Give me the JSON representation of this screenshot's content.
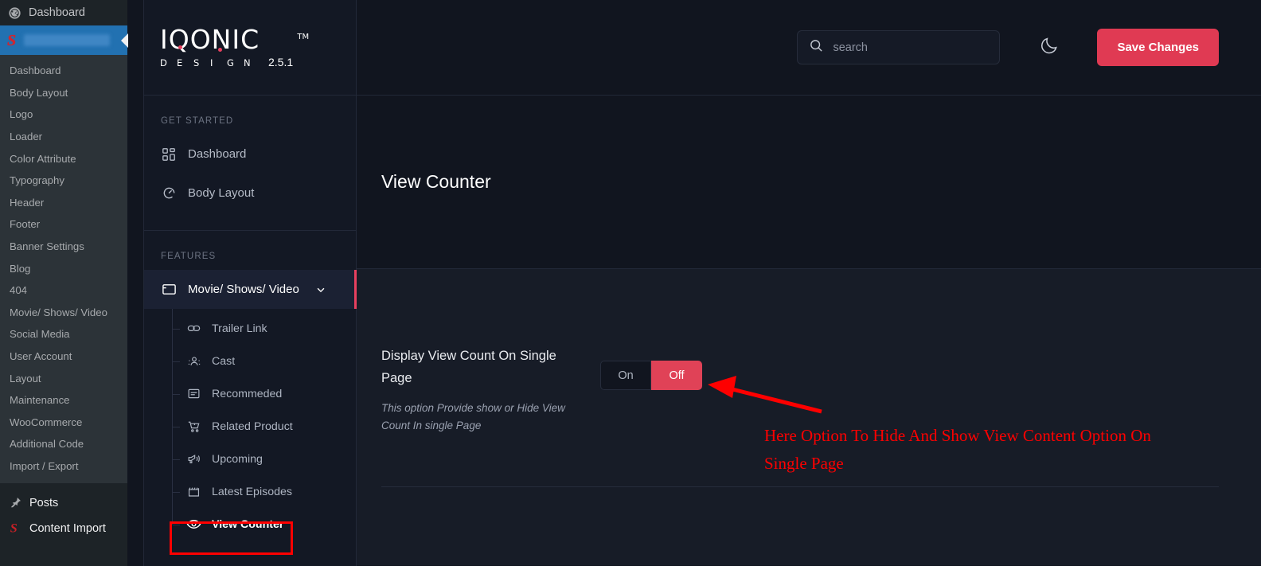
{
  "wp_admin": {
    "top_item": {
      "label": "Dashboard",
      "icon": "gauge-icon"
    },
    "active_item": {
      "logo": "S",
      "label_redacted": true
    },
    "submenu": [
      "Dashboard",
      "Body Layout",
      "Logo",
      "Loader",
      "Color Attribute",
      "Typography",
      "Header",
      "Footer",
      "Banner Settings",
      "Blog",
      "404",
      "Movie/ Shows/ Video",
      "Social Media",
      "User Account",
      "Layout",
      "Maintenance",
      "WooCommerce",
      "Additional Code",
      "Import / Export"
    ],
    "bottom_items": [
      {
        "label": "Posts",
        "icon": "pin-icon"
      },
      {
        "label": "Content Import",
        "icon": "s-logo-icon"
      }
    ]
  },
  "brand": {
    "name": "IQONIC",
    "tm": "TM",
    "subtitle_letters": [
      "D",
      "E",
      "S",
      "I",
      "G",
      "N"
    ],
    "version": "2.5.1"
  },
  "nav": {
    "sections": [
      {
        "label": "GET STARTED",
        "items": [
          {
            "label": "Dashboard",
            "icon": "grid-icon"
          },
          {
            "label": "Body Layout",
            "icon": "speedometer-icon"
          }
        ]
      },
      {
        "label": "FEATURES",
        "items": [
          {
            "label": "Movie/ Shows/ Video",
            "icon": "window-icon",
            "active": true,
            "expandable": true
          }
        ]
      }
    ],
    "submenu": [
      {
        "label": "Trailer Link",
        "icon": "link-icon"
      },
      {
        "label": "Cast",
        "icon": "people-icon"
      },
      {
        "label": "Recommeded",
        "icon": "card-text-icon"
      },
      {
        "label": "Related Product",
        "icon": "cart-icon"
      },
      {
        "label": "Upcoming",
        "icon": "megaphone-icon"
      },
      {
        "label": "Latest Episodes",
        "icon": "calendar-icon"
      },
      {
        "label": "View Counter",
        "icon": "eye-icon",
        "current": true
      }
    ]
  },
  "topbar": {
    "search_placeholder": "search",
    "search_value": "",
    "search_icon": "search-icon",
    "theme_toggle_icon": "moon-icon",
    "save_label": "Save Changes"
  },
  "page": {
    "title": "View Counter"
  },
  "setting": {
    "label": "Display View Count On Single Page",
    "description": "This option Provide show or Hide View Count In single Page",
    "options": [
      "On",
      "Off"
    ],
    "selected": "Off"
  },
  "annotations": {
    "note": "Here Option To Hide And Show View Content Option On Single Page",
    "highlight_target": "View Counter",
    "arrow_target": "Off"
  },
  "colors": {
    "accent": "#e03a53",
    "annotation": "#fe0000",
    "panel_bg": "#131824",
    "content_bg": "#171c27",
    "header_bg": "#11151f",
    "wp_blue": "#2271b1"
  }
}
